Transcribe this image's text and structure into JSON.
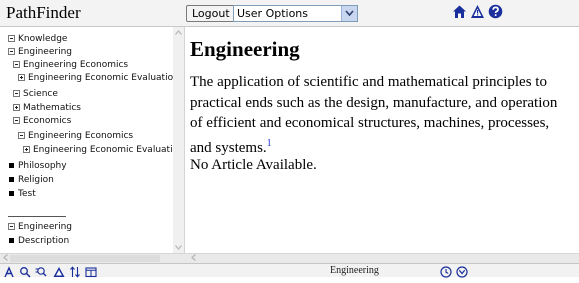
{
  "app": {
    "title": "PathFinder"
  },
  "topbar": {
    "logout_label": "Logout",
    "user_options": {
      "selected": "User Options"
    },
    "icons": [
      "home-icon",
      "warning-icon",
      "help-icon"
    ],
    "icon_color": "#1a2f9c"
  },
  "tree": {
    "items": [
      {
        "label": "Knowledge",
        "marker": "minus"
      },
      {
        "label": "Engineering",
        "marker": "minus"
      },
      {
        "label": "Engineering Economics",
        "marker": "minus"
      },
      {
        "label": "Engineering Economic Evaluation",
        "marker": "plus"
      },
      {
        "label": "Science",
        "marker": "minus"
      },
      {
        "label": "Mathematics",
        "marker": "plus"
      },
      {
        "label": "Economics",
        "marker": "minus"
      },
      {
        "label": "Engineering Economics",
        "marker": "minus"
      },
      {
        "label": "Engineering Economic Evaluation",
        "marker": "plus"
      },
      {
        "label": "Philosophy",
        "marker": "bullet"
      },
      {
        "label": "Religion",
        "marker": "bullet"
      },
      {
        "label": "Test",
        "marker": "bullet"
      }
    ],
    "context": [
      {
        "label": "Engineering",
        "marker": "minus"
      },
      {
        "label": "Description",
        "marker": "bullet"
      }
    ]
  },
  "article": {
    "title": "Engineering",
    "body": "The application of scientific and mathematical principles to practical ends such as the design, manufacture, and operation of efficient and economical structures, machines, processes, and systems.",
    "footnote": "1",
    "no_article": "No Article Available."
  },
  "bottombar": {
    "status_title": "Engineering",
    "icons": [
      "text-size-icon",
      "search-icon",
      "search-options-icon",
      "warning-icon",
      "sort-icon",
      "window-icon",
      "clock-icon",
      "settings-icon"
    ]
  }
}
